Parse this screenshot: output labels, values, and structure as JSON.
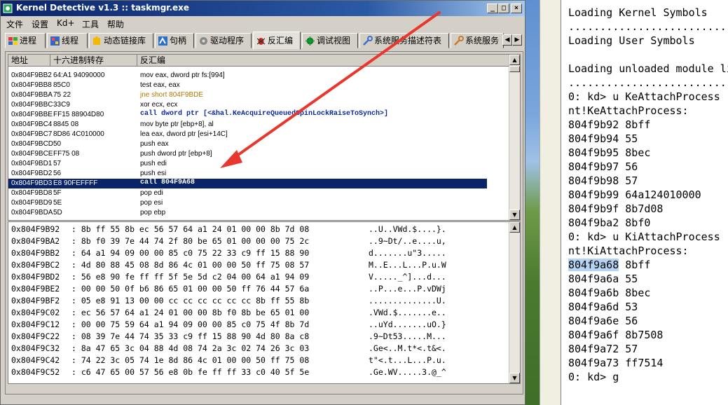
{
  "window": {
    "title": "Kernel Detective v1.3 :: taskmgr.exe",
    "controls": {
      "minimize": "_",
      "maximize": "□",
      "close": "×"
    }
  },
  "menu": [
    "文件",
    "设置",
    "Kd+",
    "工具",
    "帮助"
  ],
  "tabs": [
    {
      "label": "进程",
      "icon": "windows-flag-icon"
    },
    {
      "label": "线程",
      "icon": "grid-icon"
    },
    {
      "label": "动态链接库",
      "icon": "puzzle-icon"
    },
    {
      "label": "句柄",
      "icon": "handle-icon"
    },
    {
      "label": "驱动程序",
      "icon": "gear-icon"
    },
    {
      "label": "反汇编",
      "icon": "bug-icon",
      "active": true
    },
    {
      "label": "调试视图",
      "icon": "debug-icon"
    },
    {
      "label": "系统服务描述符表",
      "icon": "wrench-icon"
    },
    {
      "label": "系统服务",
      "icon": "wrench-icon"
    }
  ],
  "disasm": {
    "headers": [
      "地址",
      "十六进制转存",
      "反汇编"
    ],
    "rows": [
      {
        "addr": "0x804F9BB2",
        "hex": "64:A1 94090000",
        "asm": "mov eax, dword ptr fs:[994]",
        "kind": ""
      },
      {
        "addr": "0x804F9BB8",
        "hex": "85C0",
        "asm": "test eax, eax",
        "kind": ""
      },
      {
        "addr": "0x804F9BBA",
        "hex": "75 22",
        "asm": "jne short 804F9BDE",
        "kind": "jmp"
      },
      {
        "addr": "0x804F9BBC",
        "hex": "33C9",
        "asm": "xor ecx, ecx",
        "kind": ""
      },
      {
        "addr": "0x804F9BBE",
        "hex": "FF15 88904D80",
        "asm": "call dword ptr [<&hal.KeAcquireQueuedSpinLockRaiseToSynch>]",
        "kind": "call"
      },
      {
        "addr": "0x804F9BC4",
        "hex": "8845 08",
        "asm": "mov byte ptr [ebp+8], al",
        "kind": ""
      },
      {
        "addr": "0x804F9BC7",
        "hex": "8D86 4C010000",
        "asm": "lea eax, dword ptr [esi+14C]",
        "kind": ""
      },
      {
        "addr": "0x804F9BCD",
        "hex": "50",
        "asm": "push eax",
        "kind": ""
      },
      {
        "addr": "0x804F9BCE",
        "hex": "FF75 08",
        "asm": "push dword ptr [ebp+8]",
        "kind": ""
      },
      {
        "addr": "0x804F9BD1",
        "hex": "57",
        "asm": "push edi",
        "kind": ""
      },
      {
        "addr": "0x804F9BD2",
        "hex": "56",
        "asm": "push esi",
        "kind": ""
      },
      {
        "addr": "0x804F9BD3",
        "hex": "E8 90FEFFFF",
        "asm": "call 804F9A68",
        "kind": "call",
        "selected": true
      },
      {
        "addr": "0x804F9BD8",
        "hex": "5F",
        "asm": "pop edi",
        "kind": ""
      },
      {
        "addr": "0x804F9BD9",
        "hex": "5E",
        "asm": "pop esi",
        "kind": ""
      },
      {
        "addr": "0x804F9BDA",
        "hex": "5D",
        "asm": "pop ebp",
        "kind": ""
      }
    ]
  },
  "hexdump": [
    {
      "addr": "0x804F9B92",
      "bytes": ": 8b ff 55 8b ec 56 57 64 a1 24 01 00 00 8b 7d 08",
      "ascii": "..U..VWd.$....}."
    },
    {
      "addr": "0x804F9BA2",
      "bytes": ": 8b f0 39 7e 44 74 2f 80 be 65 01 00 00 00 75 2c",
      "ascii": "..9~Dt/..e....u,"
    },
    {
      "addr": "0x804F9BB2",
      "bytes": ": 64 a1 94 09 00 00 85 c0 75 22 33 c9 ff 15 88 90",
      "ascii": "d.......u\"3....."
    },
    {
      "addr": "0x804F9BC2",
      "bytes": ": 4d 80 88 45 08 8d 86 4c 01 00 00 50 ff 75 08 57",
      "ascii": "M..E...L...P.u.W"
    },
    {
      "addr": "0x804F9BD2",
      "bytes": ": 56 e8 90 fe ff ff 5f 5e 5d c2 04 00 64 a1 94 09",
      "ascii": "V....._^]...d..."
    },
    {
      "addr": "0x804F9BE2",
      "bytes": ": 00 00 50 0f b6 86 65 01 00 00 50 ff 76 44 57 6a",
      "ascii": "..P...e...P.vDWj"
    },
    {
      "addr": "0x804F9BF2",
      "bytes": ": 05 e8 91 13 00 00 cc cc cc cc cc cc 8b ff 55 8b",
      "ascii": "..............U."
    },
    {
      "addr": "0x804F9C02",
      "bytes": ": ec 56 57 64 a1 24 01 00 00 8b f0 8b be 65 01 00",
      "ascii": ".VWd.$.......e.."
    },
    {
      "addr": "0x804F9C12",
      "bytes": ": 00 00 75 59 64 a1 94 09 00 00 85 c0 75 4f 8b 7d",
      "ascii": "..uYd.......uO.}"
    },
    {
      "addr": "0x804F9C22",
      "bytes": ": 08 39 7e 44 74 35 33 c9 ff 15 88 90 4d 80 8a c8",
      "ascii": ".9~Dt53.....M..."
    },
    {
      "addr": "0x804F9C32",
      "bytes": ": 8a 47 65 3c 04 88 4d 08 74 2a 3c 02 74 26 3c 03",
      "ascii": ".Ge<..M.t*<.t&<."
    },
    {
      "addr": "0x804F9C42",
      "bytes": ": 74 22 3c 05 74 1e 8d 86 4c 01 00 00 50 ff 75 08",
      "ascii": "t\"<.t...L...P.u."
    },
    {
      "addr": "0x804F9C52",
      "bytes": ": c6 47 65 00 57 56 e8 0b fe ff ff 33 c0 40 5f 5e",
      "ascii": ".Ge.WV.....3.@_^"
    }
  ],
  "debugger": {
    "lines": [
      "Loading Kernel Symbols",
      "...............................",
      "Loading User Symbols",
      "",
      "Loading unloaded module list",
      "...............................",
      "0: kd> u KeAttachProcess",
      "nt!KeAttachProcess:",
      "804f9b92 8bff",
      "804f9b94 55",
      "804f9b95 8bec",
      "804f9b97 56",
      "804f9b98 57",
      "804f9b99 64a124010000",
      "804f9b9f 8b7d08",
      "804f9ba2 8bf0",
      "0: kd> u KiAttachProcess",
      "nt!KiAttachProcess:",
      "804f9a68 8bff",
      "804f9a6a 55",
      "804f9a6b 8bec",
      "804f9a6d 53",
      "804f9a6e 56",
      "804f9a6f 8b7508",
      "804f9a72 57",
      "804f9a73 ff7514",
      "0: kd> g"
    ],
    "highlight_line": 18,
    "highlight_text": "804f9a68"
  },
  "colors": {
    "selection": "#0a246a",
    "jmp": "#b07800",
    "call": "#0a2a9a",
    "arrow": "#e8382e",
    "highlight": "#b5d3f3"
  }
}
